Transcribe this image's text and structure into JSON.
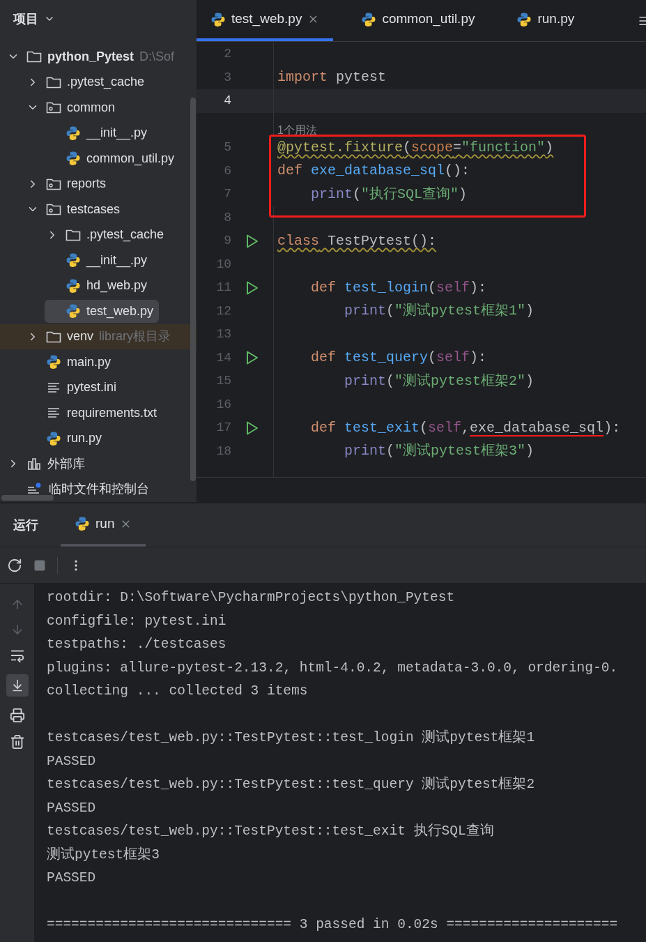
{
  "sidebar": {
    "title": "项目",
    "tree": [
      {
        "label": "python_Pytest",
        "kind": "folder",
        "hint": "D:\\Sof",
        "expanded": true,
        "selected": false,
        "children": [
          {
            "label": ".pytest_cache",
            "kind": "folder",
            "expanded": false,
            "selected": false
          },
          {
            "label": "common",
            "kind": "module_folder",
            "expanded": true,
            "selected": false,
            "children": [
              {
                "label": "__init__.py",
                "kind": "python",
                "selected": false
              },
              {
                "label": "common_util.py",
                "kind": "python",
                "selected": false
              }
            ]
          },
          {
            "label": "reports",
            "kind": "module_folder",
            "expanded": false,
            "selected": false
          },
          {
            "label": "testcases",
            "kind": "module_folder",
            "expanded": true,
            "selected": false,
            "children": [
              {
                "label": ".pytest_cache",
                "kind": "folder",
                "expanded": false,
                "selected": false
              },
              {
                "label": "__init__.py",
                "kind": "python",
                "selected": false
              },
              {
                "label": "hd_web.py",
                "kind": "python",
                "selected": false
              },
              {
                "label": "test_web.py",
                "kind": "python",
                "selected": true
              }
            ]
          },
          {
            "label": "venv",
            "kind": "excluded_folder",
            "hint": "library根目录",
            "expanded": false,
            "selected": false
          },
          {
            "label": "main.py",
            "kind": "python",
            "selected": false
          },
          {
            "label": "pytest.ini",
            "kind": "text",
            "selected": false
          },
          {
            "label": "requirements.txt",
            "kind": "text",
            "selected": false
          },
          {
            "label": "run.py",
            "kind": "python",
            "selected": false
          }
        ]
      },
      {
        "label": "外部库",
        "kind": "library",
        "expanded": false,
        "selected": false
      },
      {
        "label": "临时文件和控制台",
        "kind": "scratch",
        "selected": false
      }
    ]
  },
  "editor": {
    "tabs": [
      {
        "label": "test_web.py",
        "selected": true,
        "closable": true
      },
      {
        "label": "common_util.py",
        "selected": false,
        "closable": false
      },
      {
        "label": "run.py",
        "selected": false,
        "closable": false
      }
    ],
    "lines": [
      {
        "kind": "code",
        "number": "2",
        "current": false,
        "run": false,
        "boxed": false
      },
      {
        "kind": "code",
        "number": "3",
        "current": false,
        "run": false,
        "boxed": false,
        "warning": false,
        "tokens": [
          {
            "text": "import",
            "kind": "keyword"
          },
          {
            "text": " pytest",
            "kind": "plain"
          }
        ]
      },
      {
        "kind": "code",
        "number": "4",
        "current": true,
        "run": false,
        "boxed": false
      },
      {
        "kind": "hint",
        "text": "1个用法"
      },
      {
        "kind": "code",
        "number": "5",
        "current": false,
        "run": false,
        "boxed": true,
        "warning": true,
        "tokens": [
          {
            "text": "@pytest.fixture",
            "kind": "decorator"
          },
          {
            "text": "(",
            "kind": "plain"
          },
          {
            "text": "scope",
            "kind": "param"
          },
          {
            "text": "=",
            "kind": "plain"
          },
          {
            "text": "\"function\"",
            "kind": "string"
          },
          {
            "text": ")",
            "kind": "plain"
          }
        ]
      },
      {
        "kind": "code",
        "number": "6",
        "current": false,
        "run": false,
        "boxed": true,
        "warning": false,
        "tokens": [
          {
            "text": "def",
            "kind": "keyword"
          },
          {
            "text": " exe_database_sql",
            "kind": "function"
          },
          {
            "text": "():",
            "kind": "plain"
          }
        ]
      },
      {
        "kind": "code",
        "number": "7",
        "current": false,
        "run": false,
        "boxed": true,
        "warning": false,
        "tokens": [
          {
            "text": "    print",
            "kind": "builtin"
          },
          {
            "text": "(",
            "kind": "plain"
          },
          {
            "text": "\"执行SQL查询\"",
            "kind": "string"
          },
          {
            "text": ")",
            "kind": "plain"
          }
        ]
      },
      {
        "kind": "code",
        "number": "8",
        "current": false,
        "run": false,
        "boxed": false
      },
      {
        "kind": "code",
        "number": "9",
        "current": false,
        "run": true,
        "boxed": false,
        "warning": true,
        "tokens": [
          {
            "text": "class",
            "kind": "keyword"
          },
          {
            "text": " TestPytest():",
            "kind": "plain"
          }
        ]
      },
      {
        "kind": "code",
        "number": "10",
        "current": false,
        "run": false,
        "boxed": false
      },
      {
        "kind": "code",
        "number": "11",
        "current": false,
        "run": true,
        "boxed": false,
        "warning": false,
        "tokens": [
          {
            "text": "    def",
            "kind": "keyword"
          },
          {
            "text": " test_login",
            "kind": "function"
          },
          {
            "text": "(",
            "kind": "plain"
          },
          {
            "text": "self",
            "kind": "self"
          },
          {
            "text": "):",
            "kind": "plain"
          }
        ]
      },
      {
        "kind": "code",
        "number": "12",
        "current": false,
        "run": false,
        "boxed": false,
        "warning": false,
        "tokens": [
          {
            "text": "        print",
            "kind": "builtin"
          },
          {
            "text": "(",
            "kind": "plain"
          },
          {
            "text": "\"测试pytest框架1\"",
            "kind": "string"
          },
          {
            "text": ")",
            "kind": "plain"
          }
        ]
      },
      {
        "kind": "code",
        "number": "13",
        "current": false,
        "run": false,
        "boxed": false
      },
      {
        "kind": "code",
        "number": "14",
        "current": false,
        "run": true,
        "boxed": false,
        "warning": false,
        "tokens": [
          {
            "text": "    def",
            "kind": "keyword"
          },
          {
            "text": " test_query",
            "kind": "function"
          },
          {
            "text": "(",
            "kind": "plain"
          },
          {
            "text": "self",
            "kind": "self"
          },
          {
            "text": "):",
            "kind": "plain"
          }
        ]
      },
      {
        "kind": "code",
        "number": "15",
        "current": false,
        "run": false,
        "boxed": false,
        "warning": false,
        "tokens": [
          {
            "text": "        print",
            "kind": "builtin"
          },
          {
            "text": "(",
            "kind": "plain"
          },
          {
            "text": "\"测试pytest框架2\"",
            "kind": "string"
          },
          {
            "text": ")",
            "kind": "plain"
          }
        ]
      },
      {
        "kind": "code",
        "number": "16",
        "current": false,
        "run": false,
        "boxed": false
      },
      {
        "kind": "code",
        "number": "17",
        "current": false,
        "run": true,
        "boxed": false,
        "warning": false,
        "tokens": [
          {
            "text": "    def",
            "kind": "keyword"
          },
          {
            "text": " test_exit",
            "kind": "function"
          },
          {
            "text": "(",
            "kind": "plain"
          },
          {
            "text": "self",
            "kind": "self"
          },
          {
            "text": ",",
            "kind": "plain"
          },
          {
            "text": "exe_database_sql",
            "kind": "annotated"
          },
          {
            "text": "):",
            "kind": "plain"
          }
        ]
      },
      {
        "kind": "code",
        "number": "18",
        "current": false,
        "run": false,
        "boxed": false,
        "warning": false,
        "tokens": [
          {
            "text": "        print",
            "kind": "builtin"
          },
          {
            "text": "(",
            "kind": "plain"
          },
          {
            "text": "\"测试pytest框架3\"",
            "kind": "string"
          },
          {
            "text": ")",
            "kind": "plain"
          }
        ]
      }
    ]
  },
  "run_panel": {
    "title": "运行",
    "tabs": [
      {
        "label": "run",
        "selected": true
      }
    ],
    "console_blocks": [
      [
        "rootdir: D:\\Software\\PycharmProjects\\python_Pytest",
        "configfile: pytest.ini",
        "testpaths: ./testcases",
        "plugins: allure-pytest-2.13.2, html-4.0.2, metadata-3.0.0, ordering-0.",
        "collecting ... collected 3 items"
      ],
      [
        "testcases/test_web.py::TestPytest::test_login 测试pytest框架1",
        "PASSED",
        "testcases/test_web.py::TestPytest::test_query 测试pytest框架2",
        "PASSED",
        "testcases/test_web.py::TestPytest::test_exit 执行SQL查询",
        "测试pytest框架3",
        "PASSED"
      ],
      [
        "============================== 3 passed in 0.02s ====================="
      ]
    ]
  }
}
